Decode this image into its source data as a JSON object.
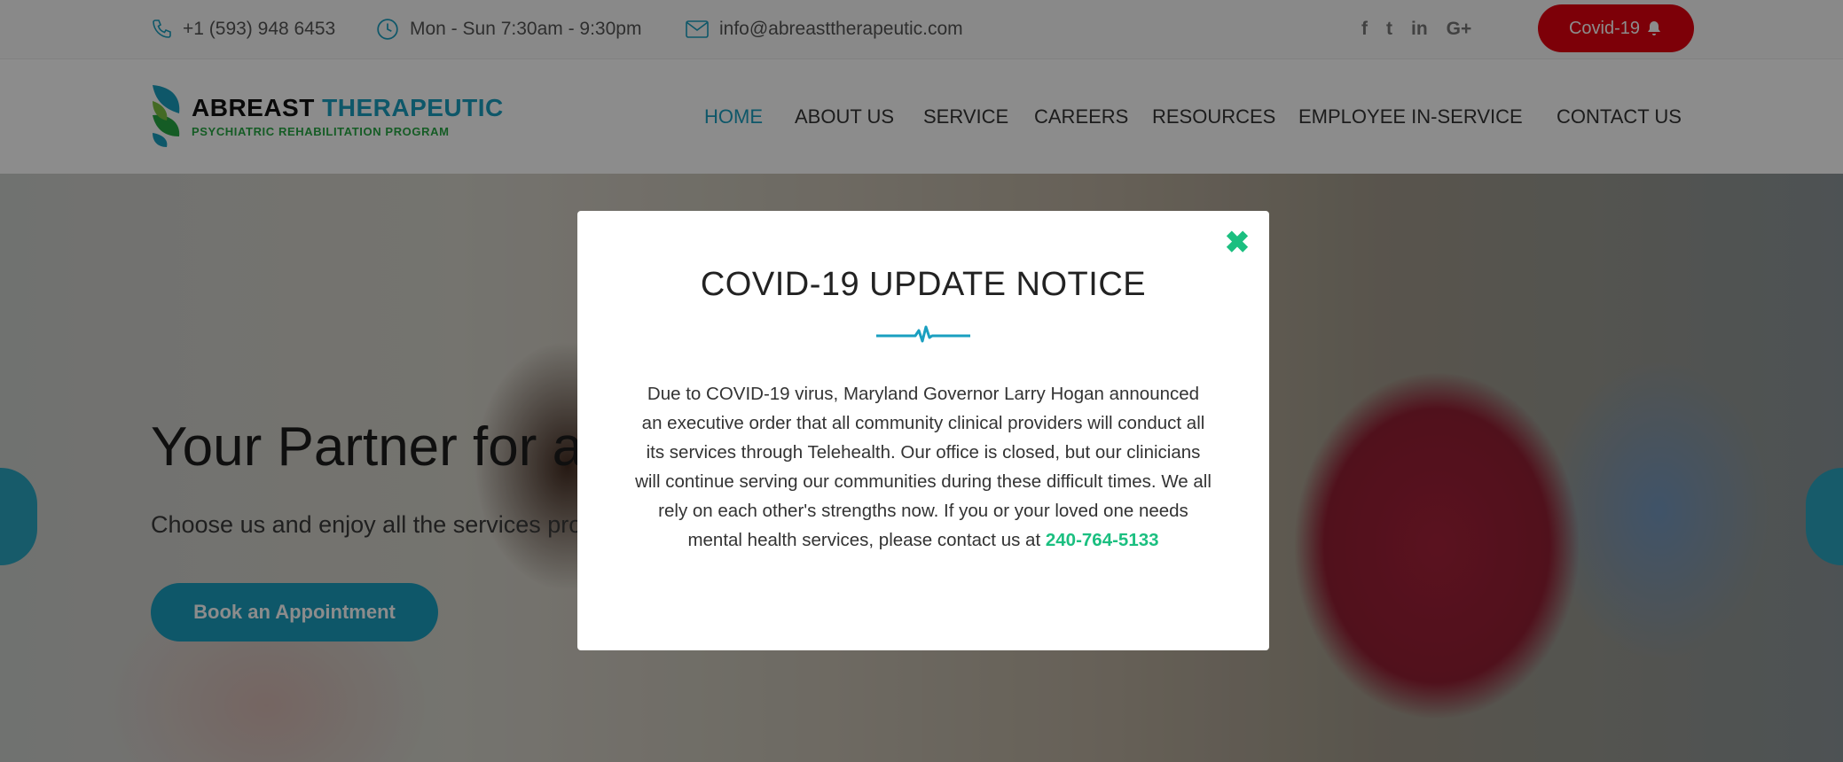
{
  "topbar": {
    "phone": "+1 (593) 948 6453",
    "hours": "Mon - Sun 7:30am - 9:30pm",
    "email": "info@abreasttherapeutic.com",
    "social": [
      "f",
      "t",
      "in",
      "G+"
    ],
    "covid_button": "Covid-19"
  },
  "logo": {
    "title_part1": "ABREAST",
    "title_part2": "THERAPEUTIC",
    "subtitle": "PSYCHIATRIC REHABILITATION  PROGRAM"
  },
  "nav": {
    "items": [
      "HOME",
      "ABOUT US",
      "SERVICE",
      "CAREERS",
      "RESOURCES",
      "EMPLOYEE IN-SERVICE",
      "CONTACT US"
    ],
    "active": "HOME"
  },
  "hero": {
    "title": "Your Partner for a b",
    "subtitle": "Choose us and enjoy all the services pro",
    "cta": "Book an Appointment"
  },
  "modal": {
    "title": "COVID-19 UPDATE NOTICE",
    "body": "Due to COVID-19 virus, Maryland Governor Larry Hogan announced an executive order that all community clinical providers will conduct all its services through Telehealth. Our office is closed, but our clinicians will continue serving our communities during these difficult times. We all rely on each other's strengths now. If you or your loved one needs mental health services, please contact us at",
    "phone": "240-764-5133",
    "close_icon": "close-icon"
  },
  "colors": {
    "brand_blue": "#1a9fc0",
    "brand_green": "#1bbf80",
    "covid_red": "#e3000f"
  }
}
